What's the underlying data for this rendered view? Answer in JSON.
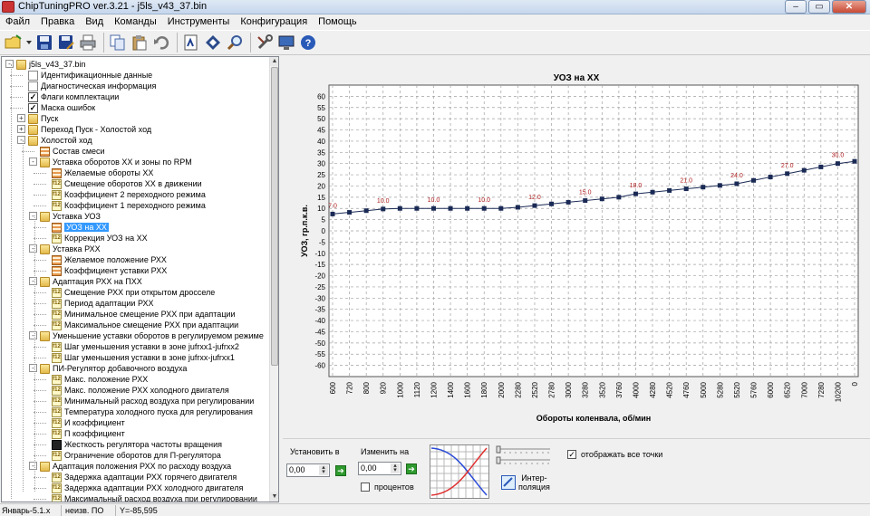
{
  "app": {
    "title": "ChipTuningPRO ver.3.21 - j5ls_v43_37.bin"
  },
  "window_buttons": [
    "–",
    "▭",
    "✕"
  ],
  "menu": [
    "Файл",
    "Правка",
    "Вид",
    "Команды",
    "Инструменты",
    "Конфигурация",
    "Помощь"
  ],
  "tree": [
    {
      "label": "j5ls_v43_37.bin",
      "level": 0,
      "icon": "folder",
      "expander": "-"
    },
    {
      "label": "Идентификационные данные",
      "level": 1,
      "icon": "doc"
    },
    {
      "label": "Диагностическая информация",
      "level": 1,
      "icon": "doc"
    },
    {
      "label": "Флаги комплектации",
      "level": 1,
      "icon": "check"
    },
    {
      "label": "Маска ошибок",
      "level": 1,
      "icon": "check"
    },
    {
      "label": "Пуск",
      "level": 1,
      "icon": "folder",
      "expander": "+"
    },
    {
      "label": "Переход Пуск - Холостой ход",
      "level": 1,
      "icon": "folder",
      "expander": "+"
    },
    {
      "label": "Холостой ход",
      "level": 1,
      "icon": "folder",
      "expander": "-"
    },
    {
      "label": "Состав смеси",
      "level": 2,
      "icon": "table"
    },
    {
      "label": "Уставка оборотов ХХ и зоны по RPM",
      "level": 2,
      "icon": "folder",
      "expander": "-"
    },
    {
      "label": "Желаемые обороты ХХ",
      "level": 3,
      "icon": "table"
    },
    {
      "label": "Смещение оборотов ХХ в движении",
      "level": 3,
      "icon": "f12"
    },
    {
      "label": "Коэффициент 2 переходного режима",
      "level": 3,
      "icon": "f12"
    },
    {
      "label": "Коэффициент 1 переходного режима",
      "level": 3,
      "icon": "f12"
    },
    {
      "label": "Уставка УОЗ",
      "level": 2,
      "icon": "folder",
      "expander": "-"
    },
    {
      "label": "УОЗ на ХХ",
      "level": 3,
      "icon": "table",
      "selected": true
    },
    {
      "label": "Коррекция УОЗ на ХХ",
      "level": 3,
      "icon": "f12"
    },
    {
      "label": "Уставка РХХ",
      "level": 2,
      "icon": "folder",
      "expander": "-"
    },
    {
      "label": "Желаемое положение РХХ",
      "level": 3,
      "icon": "table"
    },
    {
      "label": "Коэффициент уставки РХХ",
      "level": 3,
      "icon": "table"
    },
    {
      "label": "Адаптация РХХ на ПХХ",
      "level": 2,
      "icon": "folder",
      "expander": "-"
    },
    {
      "label": "Смещение РХХ при открытом дросселе",
      "level": 3,
      "icon": "f12"
    },
    {
      "label": "Период адаптации РХХ",
      "level": 3,
      "icon": "f12"
    },
    {
      "label": "Минимальное смещение РХХ при адаптации",
      "level": 3,
      "icon": "f12"
    },
    {
      "label": "Максимальное смещение РХХ при адаптации",
      "level": 3,
      "icon": "f12"
    },
    {
      "label": "Уменьшение уставки оборотов в регулируемом режиме",
      "level": 2,
      "icon": "folder",
      "expander": "-"
    },
    {
      "label": "Шаг уменьшения уставки в зоне jufrxx1-jufrxx2",
      "level": 3,
      "icon": "f12"
    },
    {
      "label": "Шаг уменьшения уставки в зоне jufrxx-jufrxx1",
      "level": 3,
      "icon": "f12"
    },
    {
      "label": "ПИ-Регулятор добавочного воздуха",
      "level": 2,
      "icon": "folder",
      "expander": "-"
    },
    {
      "label": "Макс. положение РХХ",
      "level": 3,
      "icon": "f12"
    },
    {
      "label": "Макс. положение РХХ холодного двигателя",
      "level": 3,
      "icon": "f12"
    },
    {
      "label": "Минимальный расход воздуха при регулировании",
      "level": 3,
      "icon": "f12"
    },
    {
      "label": "Температура холодного пуска для регулирования",
      "level": 3,
      "icon": "f12"
    },
    {
      "label": "И коэффициент",
      "level": 3,
      "icon": "f12"
    },
    {
      "label": "П коэффициент",
      "level": 3,
      "icon": "f12"
    },
    {
      "label": "Жесткость регулятора частоты вращения",
      "level": 3,
      "icon": "black"
    },
    {
      "label": "Ограничение оборотов для П-регулятора",
      "level": 3,
      "icon": "f12"
    },
    {
      "label": "Адаптация положения РХХ по расходу воздуха",
      "level": 2,
      "icon": "folder",
      "expander": "-"
    },
    {
      "label": "Задержка адаптации РХХ горячего двигателя",
      "level": 3,
      "icon": "f12"
    },
    {
      "label": "Задержка адаптации РХХ холодного двигателя",
      "level": 3,
      "icon": "f12"
    },
    {
      "label": "Максимальный расход воздуха при регулировании",
      "level": 3,
      "icon": "f12"
    }
  ],
  "chart_data": {
    "type": "line",
    "title": "УОЗ на ХХ",
    "xlabel": "Обороты коленвала, об/мин",
    "ylabel": "УОЗ, гр.п.к.в.",
    "ylim": [
      -65,
      65
    ],
    "yticks": [
      60,
      55,
      50,
      45,
      40,
      35,
      30,
      25,
      20,
      15,
      10,
      5,
      0,
      -5,
      -10,
      -15,
      -20,
      -25,
      -30,
      -35,
      -40,
      -45,
      -50,
      -55,
      -60
    ],
    "categories": [
      "600",
      "720",
      "800",
      "920",
      "1000",
      "1120",
      "1200",
      "1400",
      "1600",
      "1800",
      "2000",
      "2280",
      "2520",
      "2780",
      "3000",
      "3280",
      "3520",
      "3760",
      "4000",
      "4280",
      "4520",
      "4760",
      "5000",
      "5280",
      "5520",
      "5760",
      "6000",
      "6520",
      "7000",
      "7280",
      "10200",
      "0"
    ],
    "values": [
      7.5,
      8.25,
      9.0,
      9.75,
      10,
      10,
      10,
      10,
      10,
      10,
      10,
      10.5,
      11.25,
      12.0,
      12.75,
      13.5,
      14.25,
      15.0,
      16.5,
      17.25,
      18.0,
      18.75,
      19.5,
      20.25,
      21.0,
      22.5,
      24.0,
      25.5,
      27.0,
      28.5,
      30.0,
      31.0
    ],
    "data_labels": [
      {
        "index": 0,
        "text": "7.0"
      },
      {
        "index": 3,
        "text": "10.0"
      },
      {
        "index": 6,
        "text": "10.0"
      },
      {
        "index": 9,
        "text": "10.0"
      },
      {
        "index": 12,
        "text": "12.0"
      },
      {
        "index": 15,
        "text": "15.0"
      },
      {
        "index": 18,
        "text": "18.0"
      },
      {
        "index": 21,
        "text": "21.0"
      },
      {
        "index": 24,
        "text": "24.0"
      },
      {
        "index": 27,
        "text": "27.0"
      },
      {
        "index": 30,
        "text": "30.0"
      }
    ],
    "grid": true,
    "colors": {
      "line": "#1a2a55",
      "marker": "#1a2a55",
      "label": "#b02020",
      "grid": "#a0a0a0"
    }
  },
  "controls": {
    "set_label": "Установить в",
    "set_value": "0,00",
    "change_label": "Изменить на",
    "change_value": "0,00",
    "percent_label": "процентов",
    "interp_label": "Интер-\nполяция",
    "show_points_label": "отображать все точки",
    "show_points_checked": true
  },
  "status": {
    "version": "Январь-5.1.x",
    "firmware": "неизв. ПО",
    "readout": "Y=-85,595"
  }
}
